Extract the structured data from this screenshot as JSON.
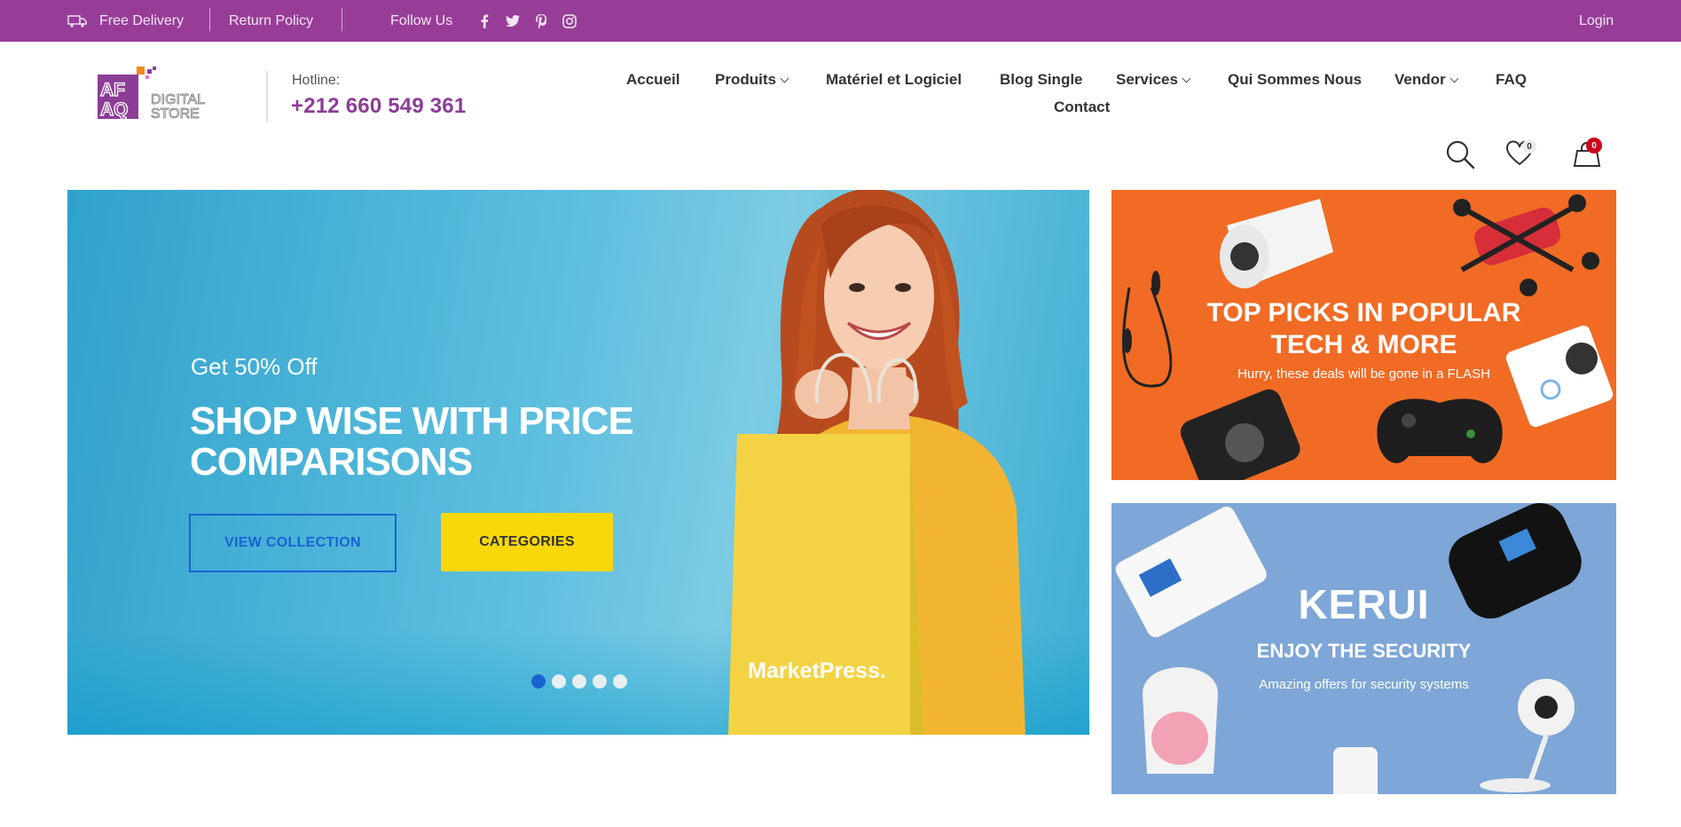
{
  "topbar": {
    "free_delivery": "Free Delivery",
    "return_policy": "Return Policy",
    "follow_us": "Follow Us",
    "social_icons": [
      "facebook-icon",
      "twitter-icon",
      "pinterest-icon",
      "instagram-icon"
    ],
    "login": "Login",
    "bg_color": "#973d98"
  },
  "header": {
    "logo": {
      "top": "AF",
      "bottom": "AQ",
      "line1": "DIGITAL",
      "line2": "STORE"
    },
    "hotline_label": "Hotline:",
    "hotline_number": "+212 660 549 361",
    "nav": {
      "accueil": "Accueil",
      "produits": "Produits",
      "materiel": "Matériel et Logiciel",
      "blog": "Blog Single",
      "services": "Services",
      "qui": "Qui Sommes Nous",
      "vendor": "Vendor",
      "faq": "FAQ",
      "contact": "Contact"
    },
    "wishlist_count": "0",
    "cart_count": "0"
  },
  "hero": {
    "subtitle": "Get 50% Off",
    "title": "SHOP WISE WITH PRICE COMPARISONS",
    "btn_collection": "VIEW COLLECTION",
    "btn_categories": "CATEGORIES",
    "bag_text": "MarketPress.",
    "slides": 5,
    "active_slide": 1
  },
  "promo1": {
    "title_line1": "TOP PICKS IN POPULAR",
    "title_line2": "TECH & MORE",
    "subtitle": "Hurry, these deals will be gone in a FLASH",
    "bg": "#f16b25"
  },
  "promo2": {
    "brand": "KERUI",
    "title": "ENJOY THE SECURITY",
    "subtitle": "Amazing offers for security systems",
    "bg": "#7ea6d6"
  }
}
